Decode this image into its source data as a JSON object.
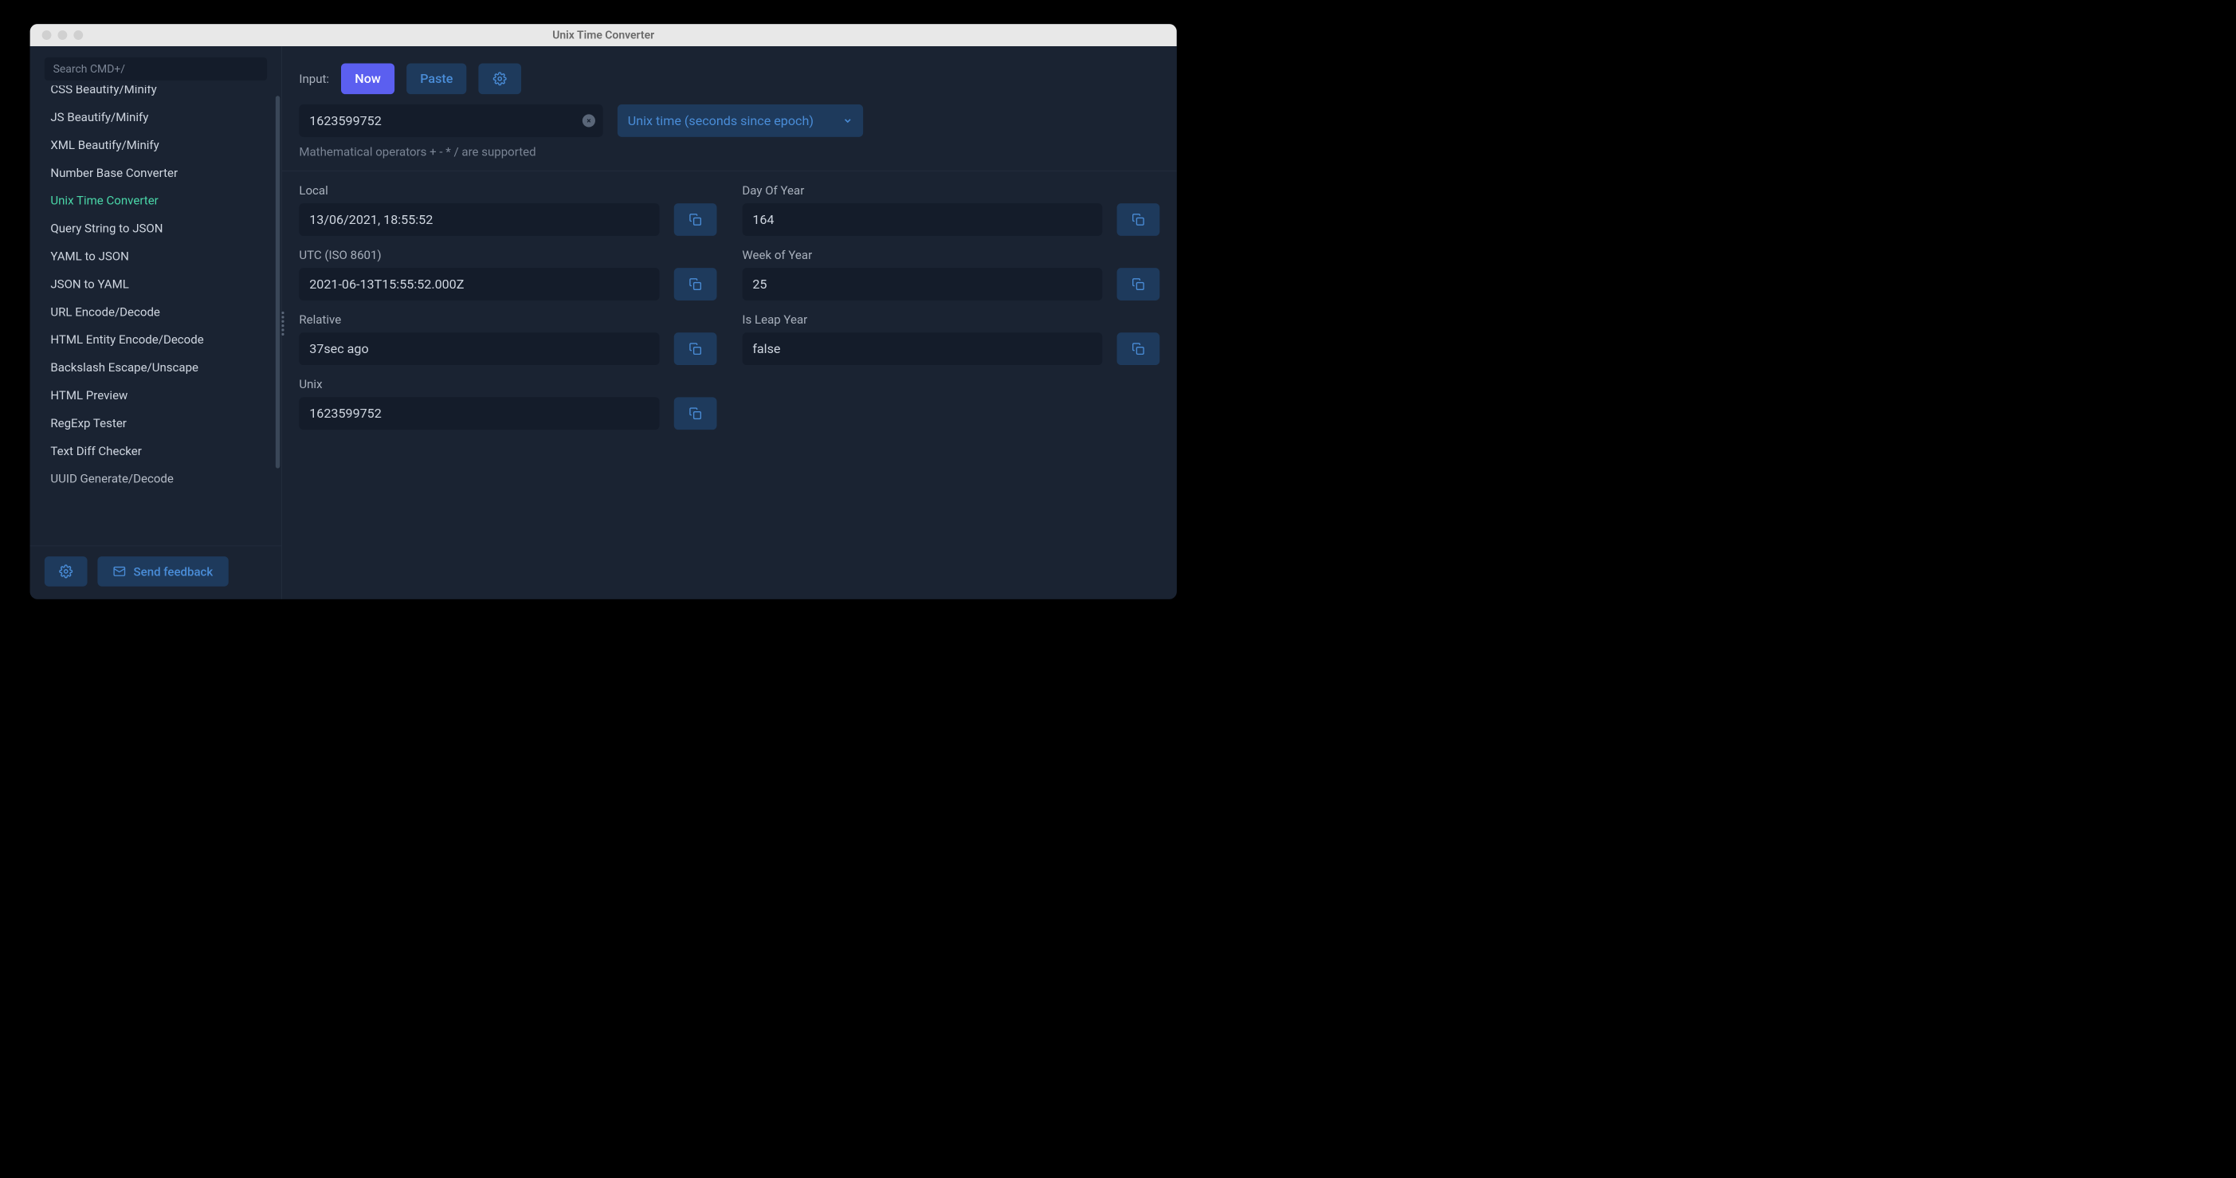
{
  "window": {
    "title": "Unix Time Converter"
  },
  "sidebar": {
    "search_placeholder": "Search CMD+/",
    "items": [
      {
        "label": "CSS Beautify/Minify",
        "active": false
      },
      {
        "label": "JS Beautify/Minify",
        "active": false
      },
      {
        "label": "XML Beautify/Minify",
        "active": false
      },
      {
        "label": "Number Base Converter",
        "active": false
      },
      {
        "label": "Unix Time Converter",
        "active": true
      },
      {
        "label": "Query String to JSON",
        "active": false
      },
      {
        "label": "YAML to JSON",
        "active": false
      },
      {
        "label": "JSON to YAML",
        "active": false
      },
      {
        "label": "URL Encode/Decode",
        "active": false
      },
      {
        "label": "HTML Entity Encode/Decode",
        "active": false
      },
      {
        "label": "Backslash Escape/Unscape",
        "active": false
      },
      {
        "label": "HTML Preview",
        "active": false
      },
      {
        "label": "RegExp Tester",
        "active": false
      },
      {
        "label": "Text Diff Checker",
        "active": false
      },
      {
        "label": "UUID Generate/Decode",
        "active": false
      }
    ],
    "feedback_label": "Send feedback"
  },
  "main": {
    "input_label": "Input:",
    "now_label": "Now",
    "paste_label": "Paste",
    "input_value": "1623599752",
    "format_selected": "Unix time (seconds since epoch)",
    "hint": "Mathematical operators + - * / are supported",
    "fields": {
      "local": {
        "label": "Local",
        "value": "13/06/2021, 18:55:52"
      },
      "utc": {
        "label": "UTC (ISO 8601)",
        "value": "2021-06-13T15:55:52.000Z"
      },
      "relative": {
        "label": "Relative",
        "value": "37sec ago"
      },
      "unix": {
        "label": "Unix",
        "value": "1623599752"
      },
      "day_of_year": {
        "label": "Day Of Year",
        "value": "164"
      },
      "week_of_year": {
        "label": "Week of Year",
        "value": "25"
      },
      "leap_year": {
        "label": "Is Leap Year",
        "value": "false"
      }
    }
  }
}
